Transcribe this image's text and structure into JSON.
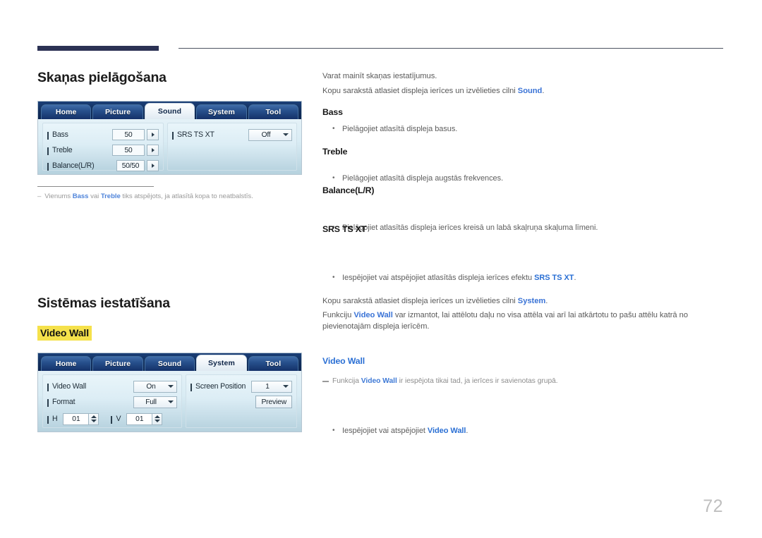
{
  "page": {
    "number": "72"
  },
  "sections": [
    {
      "title": "Skaņas pielāgošana",
      "intro": [
        {
          "text": "Varat mainīt skaņas iestatījumus."
        },
        {
          "text": "Kopu sarakstā atlasiet displeja ierīces un izvēlieties cilni Sound."
        }
      ],
      "items": [
        {
          "heading": "Bass",
          "bullet": "Pielāgojiet atlasītā displeja basus."
        },
        {
          "heading": "Treble",
          "bullet": "Pielāgojiet atlasītā displeja augstās frekvences."
        },
        {
          "heading": "Balance(L/R)",
          "bullet": "Pielāgojiet atlasītās displeja ierīces kreisā un labā skaļruņa skaļuma līmeni."
        },
        {
          "heading": "SRS TS XT",
          "bullet": "Iespējojiet vai atspējojiet atlasītās displeja ierīces efektu SRS TS XT."
        }
      ],
      "footnote": "Vienums Bass vai Treble tiks atspējots, ja atlasītā kopa to neatbalstīs."
    },
    {
      "title": "Sistēmas iestatīšana",
      "highlight_label": "Video Wall",
      "paragraphs": [
        "Kopu sarakstā atlasiet displeja ierīces un izvēlieties cilni System.",
        "Funkciju Video Wall var izmantot, lai attēlotu daļu no visa attēla vai arī lai atkārtotu to pašu attēlu katrā no pievienotajām displeja ierīcēm."
      ],
      "note": "Funkcija Video Wall ir iespējota tikai tad, ja ierīces ir savienotas grupā.",
      "items": [
        {
          "heading": "Video Wall",
          "bullet": "Iespējojiet vai atspējojiet Video Wall."
        }
      ]
    }
  ],
  "osd_sound": {
    "tabs": [
      {
        "label": "Home",
        "active": false
      },
      {
        "label": "Picture",
        "active": false
      },
      {
        "label": "Sound",
        "active": true
      },
      {
        "label": "System",
        "active": false
      },
      {
        "label": "Tool",
        "active": false
      }
    ],
    "left_rows": [
      {
        "label": "Bass",
        "value": "50"
      },
      {
        "label": "Treble",
        "value": "50"
      },
      {
        "label": "Balance(L/R)",
        "value": "50/50"
      }
    ],
    "right_rows": [
      {
        "label": "SRS TS XT",
        "value": "Off"
      }
    ]
  },
  "osd_system": {
    "tabs": [
      {
        "label": "Home",
        "active": false
      },
      {
        "label": "Picture",
        "active": false
      },
      {
        "label": "Sound",
        "active": false
      },
      {
        "label": "System",
        "active": true
      },
      {
        "label": "Tool",
        "active": false
      }
    ],
    "left_rows": [
      {
        "label": "Video Wall",
        "value": "On"
      },
      {
        "label": "Format",
        "value": "Full"
      }
    ],
    "size_row": [
      {
        "label": "H",
        "value": "01"
      },
      {
        "label": "V",
        "value": "01"
      }
    ],
    "right_rows": [
      {
        "label": "Screen Position",
        "value": "1"
      }
    ],
    "preview_label": "Preview"
  },
  "colors": {
    "header_bar": "#2c3254",
    "link_blue": "#2a6fd4",
    "highlight_yellow": "#f5e14b",
    "osd_tabbar": "#12305f"
  }
}
